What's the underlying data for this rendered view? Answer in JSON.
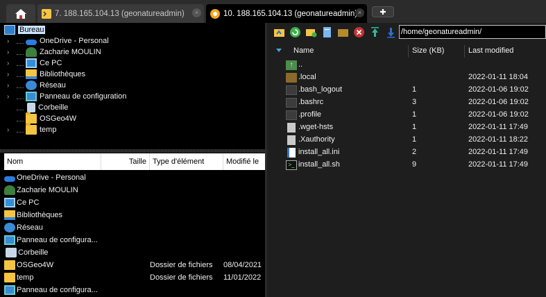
{
  "tabs": [
    {
      "label": "7. 188.165.104.13 (geonatureadmin)",
      "close": "×"
    },
    {
      "label": "10. 188.165.104.13 (geonatureadmin)",
      "close": "×"
    }
  ],
  "new_tab": "✚",
  "tree": [
    {
      "label": "Bureau",
      "icon": "desktop-icon",
      "expander": "",
      "selected": true
    },
    {
      "label": "OneDrive - Personal",
      "icon": "cloud-icon",
      "expander": "›"
    },
    {
      "label": "Zacharie MOULIN",
      "icon": "user-icon",
      "expander": "›"
    },
    {
      "label": "Ce PC",
      "icon": "computer-icon",
      "expander": "›"
    },
    {
      "label": "Bibliothèques",
      "icon": "libraries-icon",
      "expander": "›"
    },
    {
      "label": "Réseau",
      "icon": "network-icon",
      "expander": "›"
    },
    {
      "label": "Panneau de configuration",
      "icon": "control-panel-icon",
      "expander": "›"
    },
    {
      "label": "Corbeille",
      "icon": "recycle-bin-icon",
      "expander": ""
    },
    {
      "label": "OSGeo4W",
      "icon": "folder-icon",
      "expander": ""
    },
    {
      "label": "temp",
      "icon": "folder-icon",
      "expander": "›"
    }
  ],
  "local_list": {
    "columns": [
      "Nom",
      "Taille",
      "Type d'élément",
      "Modifié le"
    ],
    "rows": [
      {
        "name": "OneDrive - Personal",
        "type": "",
        "modified": "",
        "icon": "cloud-icon"
      },
      {
        "name": "Zacharie MOULIN",
        "type": "",
        "modified": "",
        "icon": "user-icon"
      },
      {
        "name": "Ce PC",
        "type": "",
        "modified": "",
        "icon": "computer-icon"
      },
      {
        "name": "Bibliothèques",
        "type": "",
        "modified": "",
        "icon": "libraries-icon"
      },
      {
        "name": "Réseau",
        "type": "",
        "modified": "",
        "icon": "network-icon"
      },
      {
        "name": "Panneau de configura...",
        "type": "",
        "modified": "",
        "icon": "control-panel-icon"
      },
      {
        "name": "Corbeille",
        "type": "",
        "modified": "",
        "icon": "recycle-bin-icon"
      },
      {
        "name": "OSGeo4W",
        "type": "Dossier de fichiers",
        "modified": "08/04/2021",
        "icon": "folder-icon"
      },
      {
        "name": "temp",
        "type": "Dossier de fichiers",
        "modified": "11/01/2022",
        "icon": "folder-icon"
      },
      {
        "name": "Panneau de configura...",
        "type": "",
        "modified": "",
        "icon": "control-panel-icon"
      }
    ]
  },
  "remote": {
    "path": "/home/geonatureadmin/",
    "columns": [
      "Name",
      "Size (KB)",
      "Last modified"
    ],
    "rows": [
      {
        "name": "..",
        "size": "",
        "date": "",
        "icon": "parent-dir-icon"
      },
      {
        "name": ".local",
        "size": "",
        "date": "2022-01-11 18:04",
        "icon": "folder-icon"
      },
      {
        "name": ".bash_logout",
        "size": "1",
        "date": "2022-01-06 19:02",
        "icon": "file-icon"
      },
      {
        "name": ".bashrc",
        "size": "3",
        "date": "2022-01-06 19:02",
        "icon": "file-icon"
      },
      {
        "name": ".profile",
        "size": "1",
        "date": "2022-01-06 19:02",
        "icon": "file-icon"
      },
      {
        "name": ".wget-hsts",
        "size": "1",
        "date": "2022-01-11 17:49",
        "icon": "document-icon"
      },
      {
        "name": ".Xauthority",
        "size": "1",
        "date": "2022-01-11 18:22",
        "icon": "document-icon"
      },
      {
        "name": "install_all.ini",
        "size": "2",
        "date": "2022-01-11 17:49",
        "icon": "ini-file-icon"
      },
      {
        "name": "install_all.sh",
        "size": "9",
        "date": "2022-01-11 17:49",
        "icon": "shell-script-icon"
      }
    ]
  }
}
